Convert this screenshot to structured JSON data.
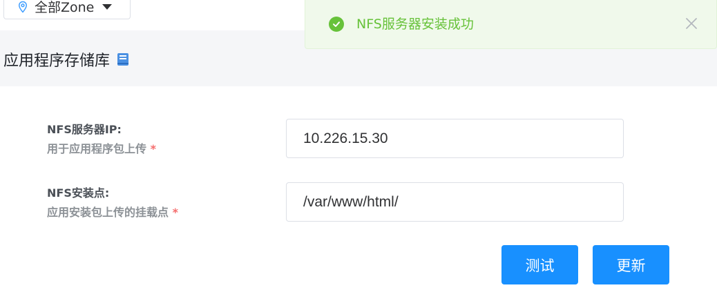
{
  "zone_selector": {
    "label": "全部Zone",
    "icons": {
      "pin": "map-pin-icon",
      "caret": "caret-down-icon"
    }
  },
  "page": {
    "title": "应用程序存储库",
    "title_icon": "book-icon"
  },
  "toast": {
    "message": "NFS服务器安装成功",
    "status": "success",
    "status_color": "#67c23a",
    "icons": {
      "status": "check-circle-icon",
      "close": "close-icon"
    }
  },
  "form": {
    "fields": [
      {
        "label": "NFS服务器IP:",
        "description": "用于应用程序包上传",
        "required_mark": "*",
        "value": "10.226.15.30"
      },
      {
        "label": "NFS安装点:",
        "description": "应用安装包上传的挂载点",
        "required_mark": "*",
        "value": "/var/www/html/"
      }
    ],
    "buttons": {
      "test": "测试",
      "update": "更新"
    }
  },
  "colors": {
    "primary": "#1890ff",
    "required": "#f56c6c",
    "header_bg": "#f5f6f8"
  }
}
